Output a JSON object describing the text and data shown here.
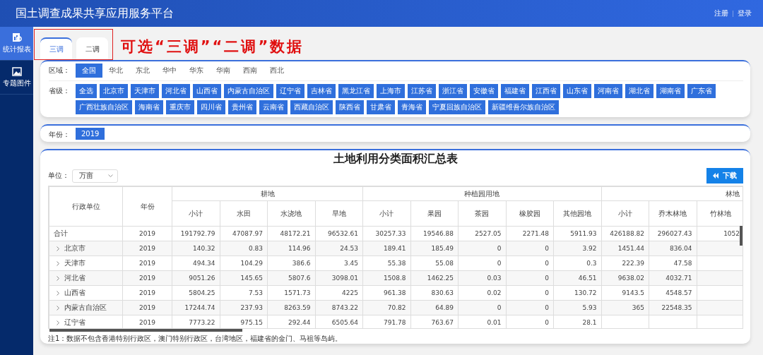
{
  "header": {
    "title": "国土调查成果共享应用服务平台",
    "links": [
      "注册",
      "登录"
    ]
  },
  "sidebar": {
    "items": [
      {
        "label": "统计报表",
        "selected": true
      },
      {
        "label": "专题图件",
        "selected": false
      }
    ]
  },
  "tabs": [
    {
      "label": "三调",
      "selected": true
    },
    {
      "label": "二调",
      "selected": false
    }
  ],
  "annotation": "可选“三调”“二调”数据",
  "filters": {
    "region_label": "区域：",
    "regions": [
      {
        "label": "全国",
        "selected": true
      },
      {
        "label": "华北",
        "selected": false
      },
      {
        "label": "东北",
        "selected": false
      },
      {
        "label": "华中",
        "selected": false
      },
      {
        "label": "华东",
        "selected": false
      },
      {
        "label": "华南",
        "selected": false
      },
      {
        "label": "西南",
        "selected": false
      },
      {
        "label": "西北",
        "selected": false
      }
    ],
    "province_label": "省级：",
    "provinces": [
      "全选",
      "北京市",
      "天津市",
      "河北省",
      "山西省",
      "内蒙古自治区",
      "辽宁省",
      "吉林省",
      "黑龙江省",
      "上海市",
      "江苏省",
      "浙江省",
      "安徽省",
      "福建省",
      "江西省",
      "山东省",
      "河南省",
      "湖北省",
      "湖南省",
      "广东省",
      "广西壮族自治区",
      "海南省",
      "重庆市",
      "四川省",
      "贵州省",
      "云南省",
      "西藏自治区",
      "陕西省",
      "甘肃省",
      "青海省",
      "宁夏回族自治区",
      "新疆维吾尔族自治区"
    ],
    "year_label": "年份：",
    "years": [
      "2019"
    ]
  },
  "report": {
    "title": "土地利用分类面积汇总表",
    "unit_label": "单位：",
    "unit_value": "万亩",
    "download": "下载",
    "table": {
      "fixed_columns": [
        "行政单位",
        "年份"
      ],
      "column_groups": [
        {
          "label": "耕地",
          "columns": [
            "小计",
            "水田",
            "水浇地",
            "旱地"
          ]
        },
        {
          "label": "种植园用地",
          "columns": [
            "小计",
            "果园",
            "茶园",
            "橡胶园",
            "其他园地"
          ]
        },
        {
          "label": "林地",
          "columns": [
            "小计",
            "乔木林地",
            "竹林地"
          ]
        }
      ],
      "rows": [
        {
          "name": "合计",
          "expandable": false,
          "year": "2019",
          "cells": [
            "191792.79",
            "47087.97",
            "48172.21",
            "96532.61",
            "30257.33",
            "19546.88",
            "2527.05",
            "2271.48",
            "5911.93",
            "426188.82",
            "296027.43",
            "1052"
          ]
        },
        {
          "name": "北京市",
          "expandable": true,
          "year": "2019",
          "cells": [
            "140.32",
            "0.83",
            "114.96",
            "24.53",
            "189.41",
            "185.49",
            "0",
            "0",
            "3.92",
            "1451.44",
            "836.04"
          ]
        },
        {
          "name": "天津市",
          "expandable": true,
          "year": "2019",
          "cells": [
            "494.34",
            "104.29",
            "386.6",
            "3.45",
            "55.38",
            "55.08",
            "0",
            "0",
            "0.3",
            "222.39",
            "47.58"
          ]
        },
        {
          "name": "河北省",
          "expandable": true,
          "year": "2019",
          "cells": [
            "9051.26",
            "145.65",
            "5807.6",
            "3098.01",
            "1508.8",
            "1462.25",
            "0.03",
            "0",
            "46.51",
            "9638.02",
            "4032.71"
          ]
        },
        {
          "name": "山西省",
          "expandable": true,
          "year": "2019",
          "cells": [
            "5804.25",
            "7.53",
            "1571.73",
            "4225",
            "961.38",
            "830.63",
            "0.02",
            "0",
            "130.72",
            "9143.5",
            "4548.57"
          ]
        },
        {
          "name": "内蒙古自治区",
          "expandable": true,
          "year": "2019",
          "cells": [
            "17244.74",
            "237.93",
            "8263.59",
            "8743.22",
            "70.82",
            "64.89",
            "0",
            "0",
            "5.93",
            "365",
            "22548.35"
          ]
        },
        {
          "name": "辽宁省",
          "expandable": true,
          "year": "2019",
          "cells": [
            "7773.22",
            "975.15",
            "292.44",
            "6505.64",
            "791.78",
            "763.67",
            "0.01",
            "0",
            "28.1"
          ]
        }
      ]
    },
    "note": "注1：数据不包含香港特别行政区，澳门特别行政区，台湾地区，福建省的金门、马祖等岛屿。"
  }
}
